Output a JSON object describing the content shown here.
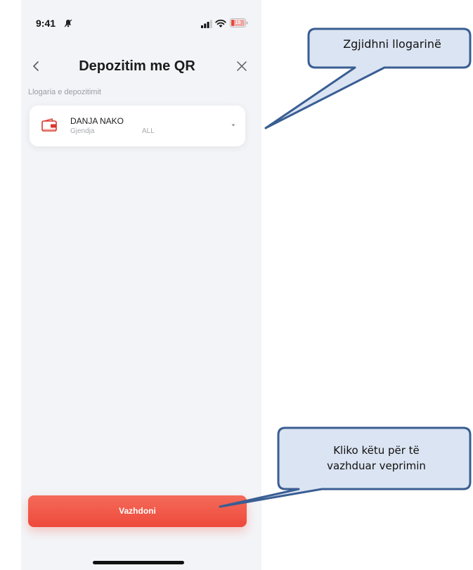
{
  "status_bar": {
    "time": "9:41",
    "battery": "15"
  },
  "header": {
    "title": "Depozitim me QR"
  },
  "account_section": {
    "label": "Llogaria e depozitimit",
    "account": {
      "name": "DANJA NAKO",
      "balance_label": "Gjendja",
      "currency": "ALL"
    }
  },
  "actions": {
    "continue_label": "Vazhdoni"
  },
  "callouts": {
    "select_account": "Zgjidhni llogarinë",
    "continue_hint_line1": "Kliko këtu për të",
    "continue_hint_line2": "vazhduar veprimin"
  },
  "colors": {
    "accent": "#ee4a3b",
    "background": "#f3f4f7",
    "callout_fill": "#dbe4f2",
    "callout_stroke": "#3a5e93"
  },
  "icons": [
    "bell-icon",
    "signal-icon",
    "wifi-icon",
    "battery-icon",
    "chevron-left-icon",
    "close-icon",
    "wallet-icon",
    "chevron-down-icon"
  ]
}
